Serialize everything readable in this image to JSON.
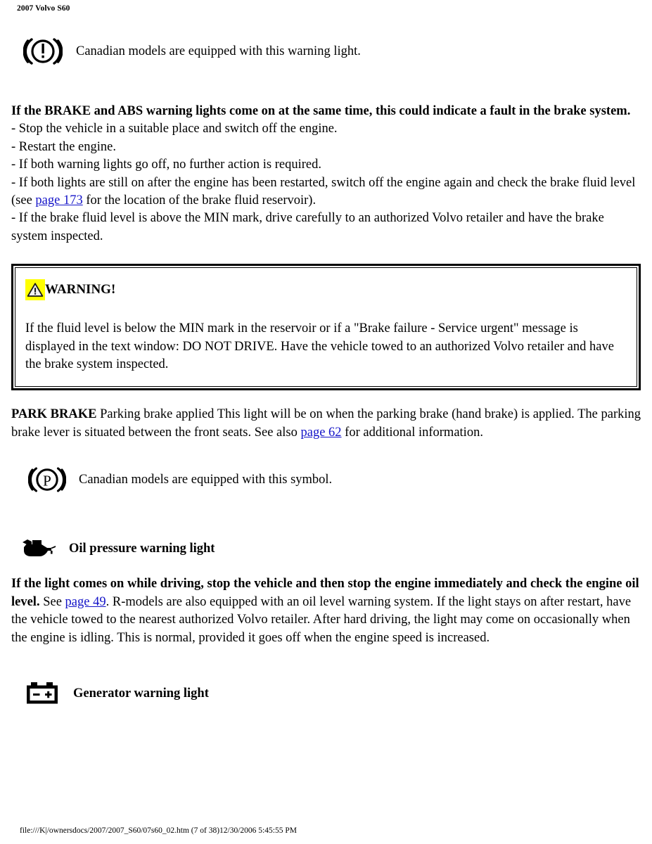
{
  "header": {
    "title": "2007 Volvo S60"
  },
  "colors": {
    "link": "#1414c8",
    "warning_highlight": "#ffff00",
    "text": "#000000",
    "background": "#ffffff"
  },
  "brake_note": {
    "icon": "brake-warning-light-icon",
    "text": "Canadian models are equipped with this warning light."
  },
  "brake_abs": {
    "heading": "If the BRAKE and ABS warning lights come on at the same time, this could indicate a fault in the brake system.",
    "bullets": [
      "- Stop the vehicle in a suitable place and switch off the engine.",
      "- Restart the engine.",
      "- If both warning lights go off, no further action is required."
    ],
    "bullet_with_link": {
      "before": "- If both lights are still on after the engine has been restarted, switch off the engine again and check the brake fluid level (see ",
      "link": "page 173",
      "after": " for the location of the brake fluid reservoir)."
    },
    "last_bullet": "- If the brake fluid level is above the MIN mark, drive carefully to an authorized Volvo retailer and have the brake system inspected."
  },
  "warning_box": {
    "icon": "warning-triangle-icon",
    "title": "WARNING!",
    "body": "If the fluid level is below the MIN mark in the reservoir or if a \"Brake failure - Service urgent\" message is displayed in the text window: DO NOT DRIVE. Have the vehicle towed to an authorized Volvo retailer and have the brake system inspected."
  },
  "park_brake": {
    "bold_lead": "PARK BRAKE",
    "text_before_link": " Parking brake applied This light will be on when the parking brake (hand brake) is applied. The parking brake lever is situated between the front seats. See also ",
    "link": "page 62",
    "text_after_link": " for additional information.",
    "icon": "park-brake-light-icon",
    "icon_note": "Canadian models are equipped with this symbol."
  },
  "oil_pressure": {
    "icon": "oil-can-icon",
    "heading": "Oil pressure warning light",
    "bold_lead": "If the light comes on while driving, stop the vehicle and then stop the engine immediately and check the engine oil level.",
    "text_before_link": " See ",
    "link": "page 49",
    "text_after_link": ". R-models are also equipped with an oil level warning system. If the light stays on after restart, have the vehicle towed to the nearest authorized Volvo retailer. After hard driving, the light may come on occasionally when the engine is idling. This is normal, provided it goes off when the engine speed is increased."
  },
  "generator": {
    "icon": "battery-icon",
    "heading": "Generator warning light"
  },
  "footer": {
    "text": "file:///K|/ownersdocs/2007/2007_S60/07s60_02.htm (7 of 38)12/30/2006 5:45:55 PM"
  }
}
